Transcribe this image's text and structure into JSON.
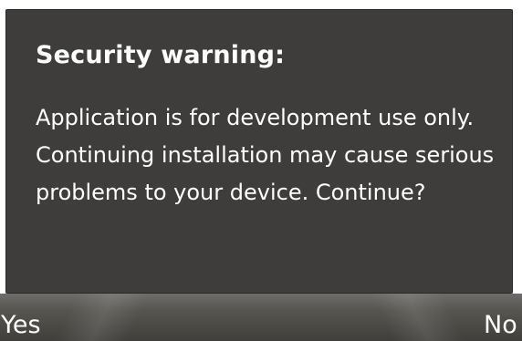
{
  "dialog": {
    "title": "Security warning:",
    "message": "Application is for development use only. Continuing installation may cause serious problems to your device. Continue?"
  },
  "softkeys": {
    "left_label": "Yes",
    "right_label": "No"
  },
  "colors": {
    "dialog_background": "#3f3d3b",
    "text": "#ffffff",
    "softkey_bar": "#56554f"
  }
}
